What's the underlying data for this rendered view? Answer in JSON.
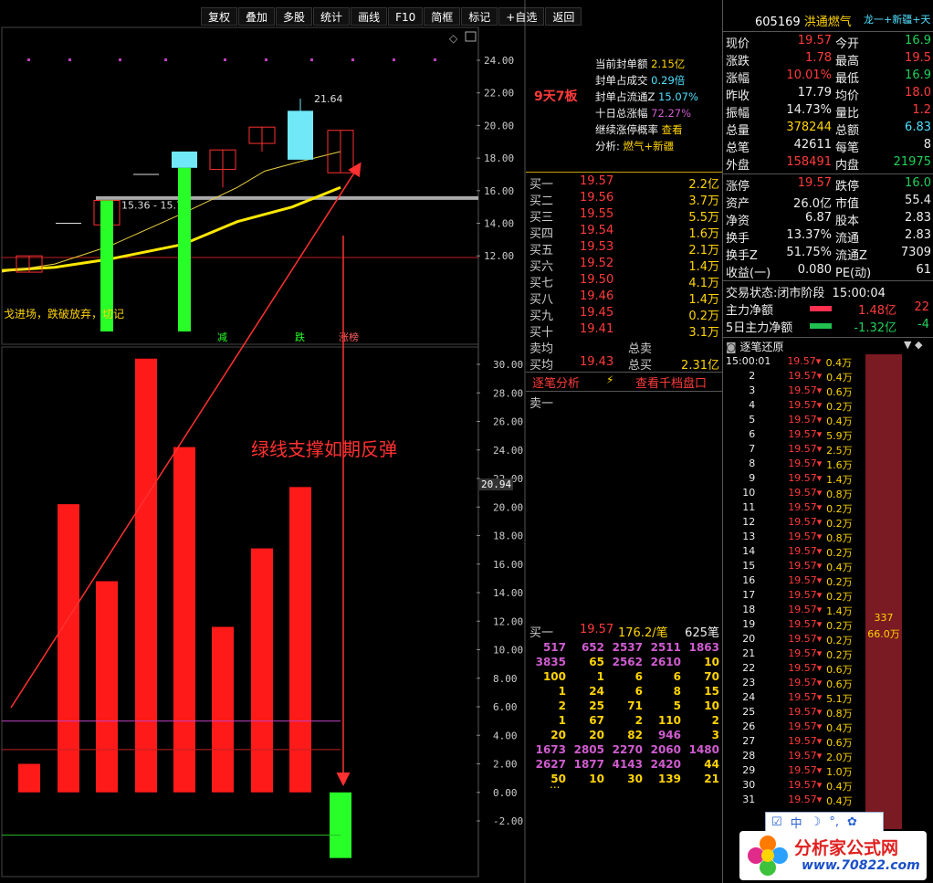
{
  "toolbar": [
    "复权",
    "叠加",
    "多股",
    "统计",
    "画线",
    "F10",
    "简框",
    "标记",
    "+自选",
    "返回"
  ],
  "stock": {
    "code": "605169",
    "name": "洪通燃气",
    "concepts": "龙一+新疆+天然"
  },
  "chart": {
    "price_axis": [
      "24.00",
      "22.00",
      "20.00",
      "18.00",
      "16.00",
      "14.00",
      "12.00"
    ],
    "high_label": "21.64",
    "range_label": "15.36 - 15.7",
    "note_left": "戈进场，跌破放弃，切记",
    "markers": [
      "减",
      "跌",
      "涨榜"
    ],
    "vol_axis": [
      "30.00",
      "28.00",
      "26.00",
      "24.00",
      "22.00",
      "20.00",
      "18.00",
      "16.00",
      "14.00",
      "12.00",
      "10.00",
      "8.00",
      "6.00",
      "4.00",
      "2.00",
      "0.00",
      "-2.00"
    ],
    "cursor_value": "20.94",
    "annotation": "绿线支撑如期反弹",
    "vol_values": [
      2,
      20.2,
      14.8,
      30.4,
      24.2,
      11.6,
      17.1,
      21.4,
      -4.6
    ],
    "vol_colors": [
      "red",
      "red",
      "red",
      "red",
      "red",
      "red",
      "red",
      "red",
      "green"
    ]
  },
  "limit_info": {
    "board": "9天7板",
    "rows": [
      {
        "k": "当前封单额",
        "v": "2.15亿",
        "c": "yellow"
      },
      {
        "k": "封单占成交",
        "v": "0.29倍",
        "c": "cyan"
      },
      {
        "k": "封单占流通Z",
        "v": "15.07%",
        "c": "cyan"
      },
      {
        "k": "十日总涨幅",
        "v": "72.27%",
        "c": "mag"
      },
      {
        "k": "继续涨停概率",
        "v": "查看",
        "c": "yellow"
      },
      {
        "k": "分析:",
        "v": "燃气+新疆",
        "c": "yellow"
      }
    ]
  },
  "bids": [
    {
      "n": "买一",
      "p": "19.57",
      "v": "2.2亿"
    },
    {
      "n": "买二",
      "p": "19.56",
      "v": "3.7万"
    },
    {
      "n": "买三",
      "p": "19.55",
      "v": "5.5万"
    },
    {
      "n": "买四",
      "p": "19.54",
      "v": "1.6万"
    },
    {
      "n": "买五",
      "p": "19.53",
      "v": "2.1万"
    },
    {
      "n": "买六",
      "p": "19.52",
      "v": "1.4万"
    },
    {
      "n": "买七",
      "p": "19.50",
      "v": "4.1万"
    },
    {
      "n": "买八",
      "p": "19.46",
      "v": "1.4万"
    },
    {
      "n": "买九",
      "p": "19.45",
      "v": "0.2万"
    },
    {
      "n": "买十",
      "p": "19.41",
      "v": "3.1万"
    }
  ],
  "avg": {
    "sell_label": "卖均",
    "sell_total_label": "总卖",
    "buy_label": "买均",
    "buy_price": "19.43",
    "buy_total_label": "总买",
    "buy_total": "2.31亿"
  },
  "tabs": {
    "left": "逐笔分析",
    "right": "查看千档盘口",
    "sell_one": "卖一"
  },
  "queue": {
    "head": {
      "n": "买一",
      "p": "19.57",
      "v": "176.2/笔",
      "c": "625笔"
    },
    "rows": [
      [
        "517",
        "652",
        "2537",
        "2511",
        "1863"
      ],
      [
        "3835",
        "65",
        "2562",
        "2610",
        "10"
      ],
      [
        "100",
        "1",
        "6",
        "6",
        "70"
      ],
      [
        "1",
        "24",
        "6",
        "8",
        "15"
      ],
      [
        "2",
        "25",
        "71",
        "5",
        "10"
      ],
      [
        "1",
        "67",
        "2",
        "110",
        "2"
      ],
      [
        "20",
        "20",
        "82",
        "946",
        "3"
      ],
      [
        "1673",
        "2805",
        "2270",
        "2060",
        "1480"
      ],
      [
        "2627",
        "1877",
        "4143",
        "2420",
        "44"
      ],
      [
        "50",
        "10",
        "30",
        "139",
        "21"
      ]
    ],
    "more": "..."
  },
  "quote": [
    {
      "a": "现价",
      "av": "19.57",
      "ac": "red",
      "b": "今开",
      "bv": "16.9",
      "bc": "green"
    },
    {
      "a": "涨跌",
      "av": "1.78",
      "ac": "red",
      "b": "最高",
      "bv": "19.5",
      "bc": "red"
    },
    {
      "a": "涨幅",
      "av": "10.01%",
      "ac": "red",
      "b": "最低",
      "bv": "16.9",
      "bc": "green"
    },
    {
      "a": "昨收",
      "av": "17.79",
      "ac": "white",
      "b": "均价",
      "bv": "18.0",
      "bc": "red"
    },
    {
      "a": "振幅",
      "av": "14.73%",
      "ac": "white",
      "b": "量比",
      "bv": "1.2",
      "bc": "red"
    },
    {
      "a": "总量",
      "av": "378244",
      "ac": "yellow",
      "b": "总额",
      "bv": "6.83",
      "bc": "cyan"
    },
    {
      "a": "总笔",
      "av": "42611",
      "ac": "white",
      "b": "每笔",
      "bv": "8",
      "bc": "white"
    },
    {
      "a": "外盘",
      "av": "158491",
      "ac": "red",
      "b": "内盘",
      "bv": "21975",
      "bc": "green"
    }
  ],
  "quote2": [
    {
      "a": "涨停",
      "av": "19.57",
      "ac": "red",
      "b": "跌停",
      "bv": "16.0",
      "bc": "green"
    },
    {
      "a": "资产",
      "av": "26.0亿",
      "ac": "white",
      "b": "市值",
      "bv": "55.4",
      "bc": "white"
    },
    {
      "a": "净资",
      "av": "6.87",
      "ac": "white",
      "b": "股本",
      "bv": "2.83",
      "bc": "white"
    },
    {
      "a": "换手",
      "av": "13.37%",
      "ac": "white",
      "b": "流通",
      "bv": "2.83",
      "bc": "white"
    },
    {
      "a": "换手Z",
      "av": "51.75%",
      "ac": "white",
      "b": "流通Z",
      "bv": "7309",
      "bc": "white"
    },
    {
      "a": "收益(一)",
      "av": "0.080",
      "ac": "white",
      "b": "PE(动)",
      "bv": "61",
      "bc": "white"
    }
  ],
  "trade_status": {
    "label": "交易状态:",
    "value": "闭市阶段",
    "time": "15:00:04"
  },
  "capital": [
    {
      "k": "主力净额",
      "v": "1.48亿",
      "c": "red",
      "x": "22"
    },
    {
      "k": "5日主力净额",
      "v": "-1.32亿",
      "c": "green",
      "x": "-4"
    }
  ],
  "ticks_title": "逐笔还原",
  "ticks": [
    {
      "t": "15:00:01",
      "p": "19.57",
      "v": "0.4万"
    },
    {
      "t": "2",
      "p": "19.57",
      "v": "0.4万"
    },
    {
      "t": "3",
      "p": "19.57",
      "v": "0.6万"
    },
    {
      "t": "4",
      "p": "19.57",
      "v": "0.2万"
    },
    {
      "t": "5",
      "p": "19.57",
      "v": "0.4万"
    },
    {
      "t": "6",
      "p": "19.57",
      "v": "5.9万"
    },
    {
      "t": "7",
      "p": "19.57",
      "v": "2.5万"
    },
    {
      "t": "8",
      "p": "19.57",
      "v": "1.6万"
    },
    {
      "t": "9",
      "p": "19.57",
      "v": "1.4万"
    },
    {
      "t": "10",
      "p": "19.57",
      "v": "0.8万"
    },
    {
      "t": "11",
      "p": "19.57",
      "v": "0.2万"
    },
    {
      "t": "12",
      "p": "19.57",
      "v": "0.2万"
    },
    {
      "t": "13",
      "p": "19.57",
      "v": "0.8万"
    },
    {
      "t": "14",
      "p": "19.57",
      "v": "0.2万"
    },
    {
      "t": "15",
      "p": "19.57",
      "v": "0.4万"
    },
    {
      "t": "16",
      "p": "19.57",
      "v": "0.2万"
    },
    {
      "t": "17",
      "p": "19.57",
      "v": "0.2万"
    },
    {
      "t": "18",
      "p": "19.57",
      "v": "1.4万"
    },
    {
      "t": "19",
      "p": "19.57",
      "v": "0.2万"
    },
    {
      "t": "20",
      "p": "19.57",
      "v": "0.2万"
    },
    {
      "t": "21",
      "p": "19.57",
      "v": "0.2万"
    },
    {
      "t": "22",
      "p": "19.57",
      "v": "0.6万"
    },
    {
      "t": "23",
      "p": "19.57",
      "v": "0.6万"
    },
    {
      "t": "24",
      "p": "19.57",
      "v": "5.1万"
    },
    {
      "t": "25",
      "p": "19.57",
      "v": "0.8万"
    },
    {
      "t": "26",
      "p": "19.57",
      "v": "0.4万"
    },
    {
      "t": "27",
      "p": "19.57",
      "v": "0.6万"
    },
    {
      "t": "28",
      "p": "19.57",
      "v": "2.0万"
    },
    {
      "t": "29",
      "p": "19.57",
      "v": "1.0万"
    },
    {
      "t": "30",
      "p": "19.57",
      "v": "0.4万"
    },
    {
      "t": "31",
      "p": "19.57",
      "v": "0.4万"
    }
  ],
  "tick_bar": {
    "top": "337",
    "bottom": "66.0万"
  },
  "ime": {
    "lang": "中"
  },
  "watermark": {
    "name": "分析家公式网",
    "url": "www.70822.com"
  }
}
